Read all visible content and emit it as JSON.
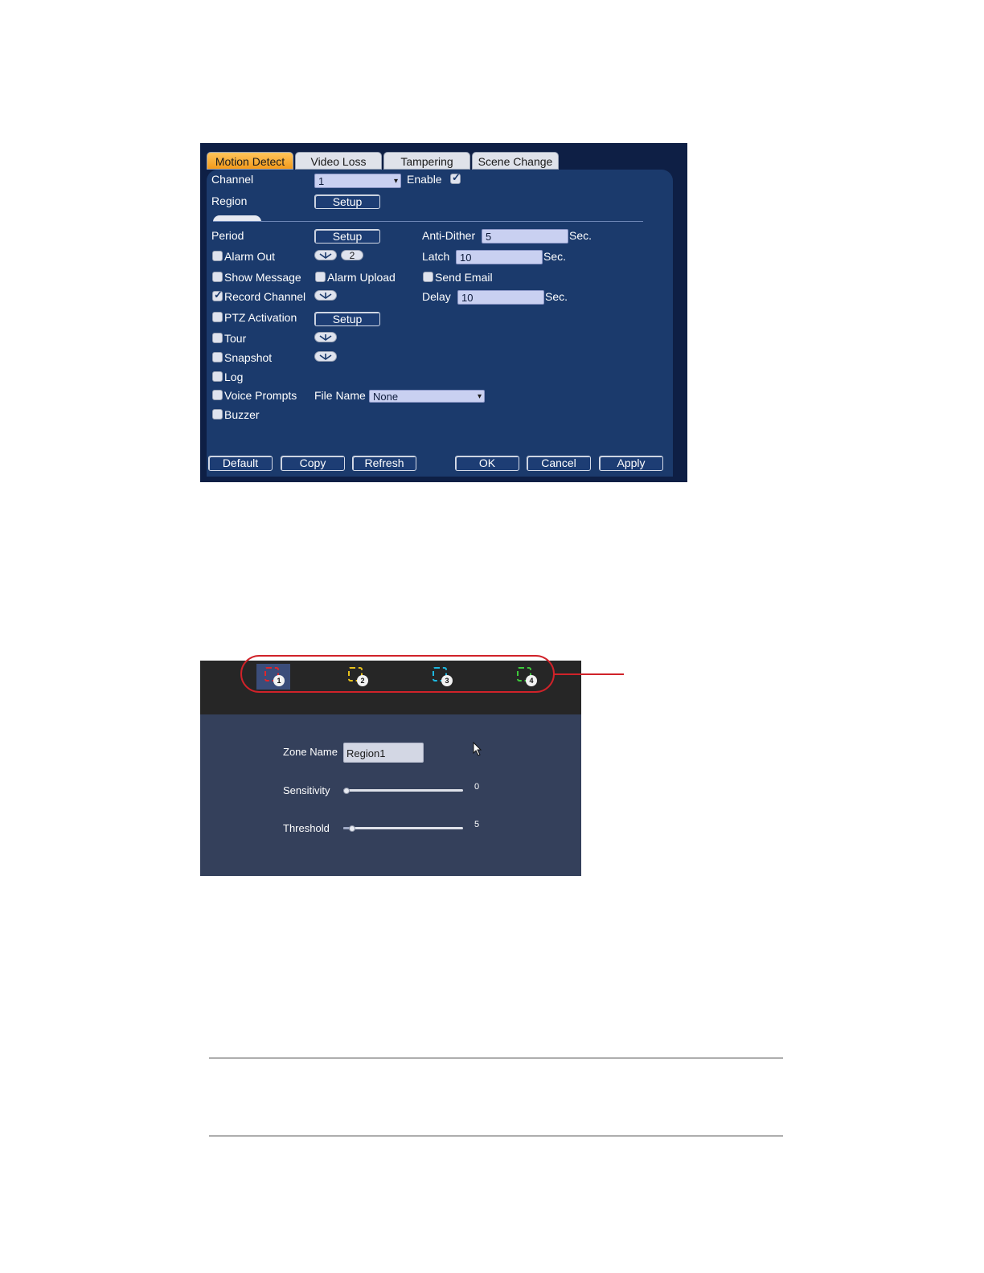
{
  "motion_dialog": {
    "tabs": [
      "Motion Detect",
      "Video Loss",
      "Tampering",
      "Scene Change"
    ],
    "active_tab": "Motion Detect",
    "channel": {
      "label": "Channel",
      "value": "1"
    },
    "enable": {
      "label": "Enable",
      "checked": true
    },
    "region": {
      "label": "Region",
      "button": "Setup"
    },
    "period": {
      "label": "Period",
      "button": "Setup"
    },
    "anti_dither": {
      "label": "Anti-Dither",
      "value": "5",
      "unit": "Sec."
    },
    "alarm_out": {
      "label": "Alarm Out",
      "checked": false,
      "value": "2"
    },
    "latch": {
      "label": "Latch",
      "value": "10",
      "unit": "Sec."
    },
    "show_message": {
      "label": "Show Message",
      "checked": false
    },
    "alarm_upload": {
      "label": "Alarm Upload",
      "checked": false
    },
    "send_email": {
      "label": "Send Email",
      "checked": false
    },
    "record_channel": {
      "label": "Record Channel",
      "checked": true
    },
    "delay": {
      "label": "Delay",
      "value": "10",
      "unit": "Sec."
    },
    "ptz_activation": {
      "label": "PTZ Activation",
      "checked": false,
      "button": "Setup"
    },
    "tour": {
      "label": "Tour",
      "checked": false
    },
    "snapshot": {
      "label": "Snapshot",
      "checked": false
    },
    "log": {
      "label": "Log",
      "checked": false
    },
    "voice_prompts": {
      "label": "Voice Prompts",
      "checked": false
    },
    "file_name": {
      "label": "File Name",
      "value": "None"
    },
    "buzzer": {
      "label": "Buzzer",
      "checked": false
    },
    "buttons": {
      "default": "Default",
      "copy": "Copy",
      "refresh": "Refresh",
      "ok": "OK",
      "cancel": "Cancel",
      "apply": "Apply"
    },
    "colors": {
      "background": "#1b3a6c",
      "active_tab": "#f39a1b",
      "field": "#c9d0f1"
    }
  },
  "zone_panel": {
    "regions": [
      {
        "number": "1",
        "color": "#e0262b",
        "selected": true
      },
      {
        "number": "2",
        "color": "#e8c21c",
        "selected": false
      },
      {
        "number": "3",
        "color": "#1db8e0",
        "selected": false
      },
      {
        "number": "4",
        "color": "#3ec93b",
        "selected": false
      }
    ],
    "zone_name": {
      "label": "Zone Name",
      "value": "Region1"
    },
    "sensitivity": {
      "label": "Sensitivity",
      "value": "0"
    },
    "threshold": {
      "label": "Threshold",
      "value": "5"
    },
    "highlight_color": "#d02229"
  }
}
